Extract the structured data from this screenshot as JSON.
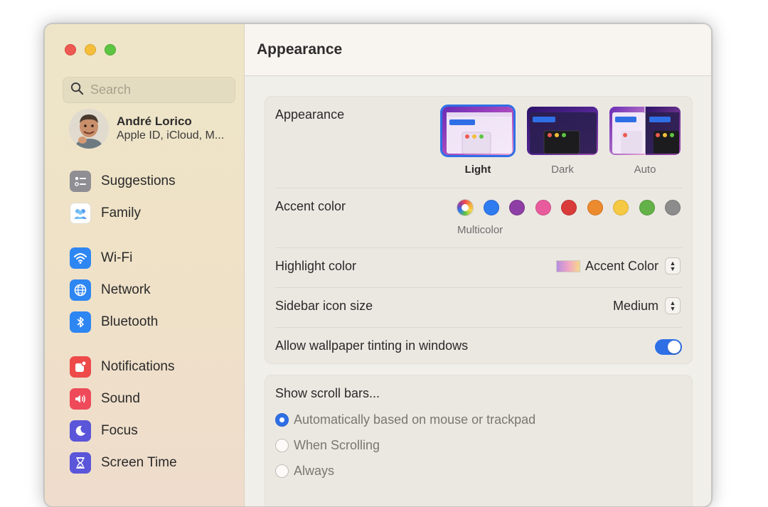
{
  "window": {
    "title": "Appearance"
  },
  "sidebar": {
    "search_placeholder": "Search",
    "account": {
      "name": "André Lorico",
      "subtitle": "Apple ID, iCloud, M..."
    },
    "items": [
      {
        "label": "Suggestions",
        "icon": "suggestions-icon",
        "color": "#8e8e93"
      },
      {
        "label": "Family",
        "icon": "family-icon",
        "color": "#ffffff"
      },
      {
        "label": "Wi-Fi",
        "icon": "wifi-icon",
        "color": "#2e86f2"
      },
      {
        "label": "Network",
        "icon": "globe-icon",
        "color": "#2e86f2"
      },
      {
        "label": "Bluetooth",
        "icon": "bluetooth-icon",
        "color": "#2e86f2"
      },
      {
        "label": "Notifications",
        "icon": "bell-icon",
        "color": "#ee4a4a"
      },
      {
        "label": "Sound",
        "icon": "speaker-icon",
        "color": "#ee4a5a"
      },
      {
        "label": "Focus",
        "icon": "moon-icon",
        "color": "#5a55d9"
      },
      {
        "label": "Screen Time",
        "icon": "hourglass-icon",
        "color": "#5a55d9"
      }
    ]
  },
  "appearance_group": {
    "appearance_label": "Appearance",
    "themes": [
      {
        "label": "Light",
        "selected": true
      },
      {
        "label": "Dark",
        "selected": false
      },
      {
        "label": "Auto",
        "selected": false
      }
    ],
    "accent_label": "Accent color",
    "accent_colors": [
      {
        "name": "Multicolor",
        "color": "multicolor",
        "selected": true
      },
      {
        "name": "Blue",
        "color": "#2f7bf0"
      },
      {
        "name": "Purple",
        "color": "#8e3fa5"
      },
      {
        "name": "Pink",
        "color": "#e85c9d"
      },
      {
        "name": "Red",
        "color": "#d93b3b"
      },
      {
        "name": "Orange",
        "color": "#ec8a2e"
      },
      {
        "name": "Yellow",
        "color": "#f6c944"
      },
      {
        "name": "Green",
        "color": "#63b148"
      },
      {
        "name": "Graphite",
        "color": "#8c8c8c"
      }
    ],
    "accent_selected_caption": "Multicolor",
    "highlight_label": "Highlight color",
    "highlight_value": "Accent Color",
    "sidebar_icon_label": "Sidebar icon size",
    "sidebar_icon_value": "Medium",
    "tinting_label": "Allow wallpaper tinting in windows",
    "tinting_enabled": true
  },
  "scroll_group": {
    "title": "Show scroll bars...",
    "options": [
      {
        "label": "Automatically based on mouse or trackpad",
        "selected": true
      },
      {
        "label": "When Scrolling",
        "selected": false
      },
      {
        "label": "Always",
        "selected": false
      }
    ]
  },
  "colors": {
    "accent": "#2f6fe6"
  }
}
